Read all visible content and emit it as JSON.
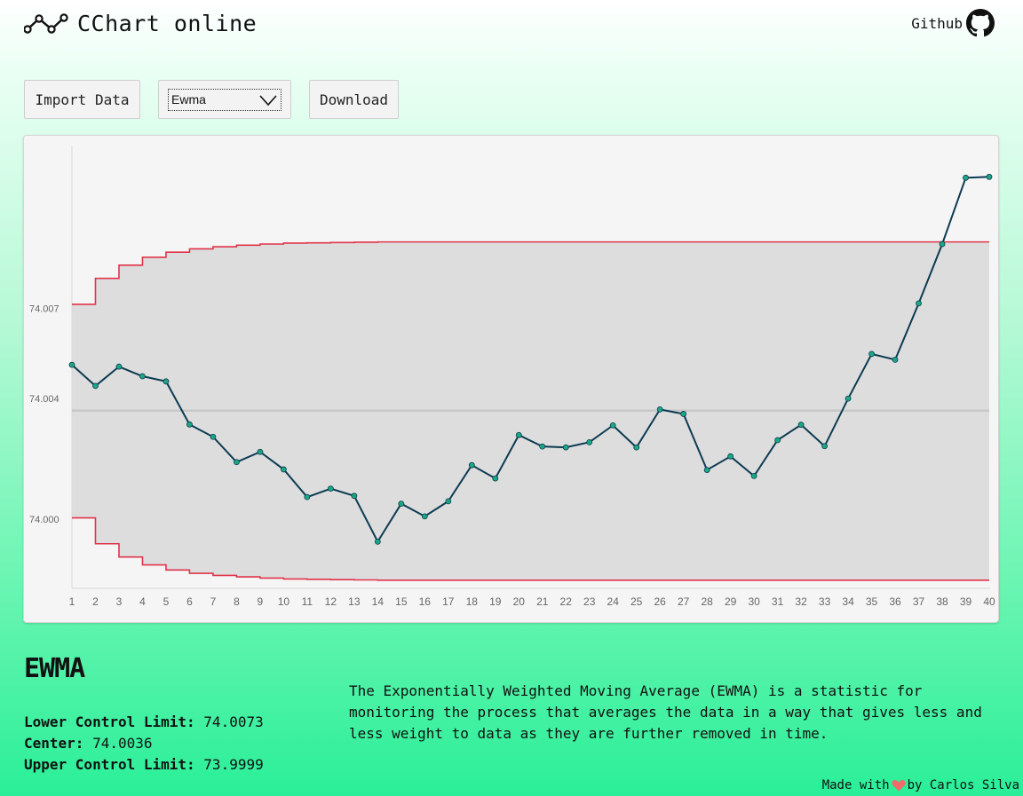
{
  "header": {
    "title": "CChart online",
    "github_label": "Github"
  },
  "toolbar": {
    "import_label": "Import Data",
    "chart_type_value": "Ewma",
    "download_label": "Download"
  },
  "chart_data": {
    "type": "line",
    "x": [
      1,
      2,
      3,
      4,
      5,
      6,
      7,
      8,
      9,
      10,
      11,
      12,
      13,
      14,
      15,
      16,
      17,
      18,
      19,
      20,
      21,
      22,
      23,
      24,
      25,
      26,
      27,
      28,
      29,
      30,
      31,
      32,
      33,
      34,
      35,
      36,
      37,
      38,
      39,
      40
    ],
    "y_ticks": [
      "74.000",
      "74.004",
      "74.007"
    ],
    "ylim": [
      73.9977,
      74.0124
    ],
    "series": [
      {
        "role": "ewma",
        "values": [
          74.00512,
          74.00442,
          74.00506,
          74.00474,
          74.00457,
          74.00314,
          74.00273,
          74.00189,
          74.00223,
          74.00165,
          74.00073,
          74.00101,
          74.00077,
          73.99925,
          74.00051,
          74.00009,
          74.00059,
          74.00179,
          74.00135,
          74.00279,
          74.00241,
          74.00238,
          74.00255,
          74.00311,
          74.00238,
          74.00364,
          74.00349,
          74.00163,
          74.00208,
          74.00143,
          74.00262,
          74.00313,
          74.00242,
          74.004,
          74.00548,
          74.00529,
          74.00716,
          74.00913,
          74.01133,
          74.01136
        ]
      },
      {
        "role": "center",
        "values": [
          74.0036
        ]
      },
      {
        "role": "ucl",
        "values": [
          74.00713,
          74.00799,
          74.00843,
          74.00869,
          74.00886,
          74.00897,
          74.00904,
          74.00909,
          74.00913,
          74.00916,
          74.00917,
          74.00918,
          74.00919,
          74.0092,
          74.0092,
          74.0092,
          74.0092,
          74.0092,
          74.0092,
          74.0092,
          74.0092,
          74.0092,
          74.0092,
          74.0092,
          74.0092,
          74.0092,
          74.0092,
          74.0092,
          74.0092,
          74.0092,
          74.0092,
          74.0092,
          74.0092,
          74.0092,
          74.0092,
          74.0092,
          74.0092,
          74.0092,
          74.0092,
          74.0092
        ]
      },
      {
        "role": "lcl",
        "values": [
          74.00004,
          73.99918,
          73.99874,
          73.99848,
          73.99831,
          73.9982,
          73.99813,
          73.99808,
          73.99804,
          73.99801,
          73.998,
          73.99799,
          73.99798,
          73.99797,
          73.99797,
          73.99797,
          73.99797,
          73.99797,
          73.99797,
          73.99797,
          73.99797,
          73.99797,
          73.99797,
          73.99797,
          73.99797,
          73.99797,
          73.99797,
          73.99797,
          73.99797,
          73.99797,
          73.99797,
          73.99797,
          73.99797,
          73.99797,
          73.99797,
          73.99797,
          73.99797,
          73.99797,
          73.99797,
          73.99797
        ]
      }
    ],
    "colors": {
      "line": "#0d3b52",
      "point": "#1aa883",
      "limits": "#e0344a",
      "center": "#c8c8c8",
      "band": "#dddddd"
    },
    "grid": false
  },
  "summary": {
    "method_title": "EWMA",
    "lcl_label": "Lower Control Limit:",
    "lcl_value": "74.0073",
    "center_label": "Center:",
    "center_value": "74.0036",
    "ucl_label": "Upper Control Limit:",
    "ucl_value": "73.9999",
    "description": "The Exponentially Weighted Moving Average (EWMA) is a statistic for monitoring the process that averages the data in a way that gives less and less weight to data as they are further removed in time."
  },
  "footer": {
    "made_with": "Made with",
    "by": "by Carlos Silva"
  }
}
